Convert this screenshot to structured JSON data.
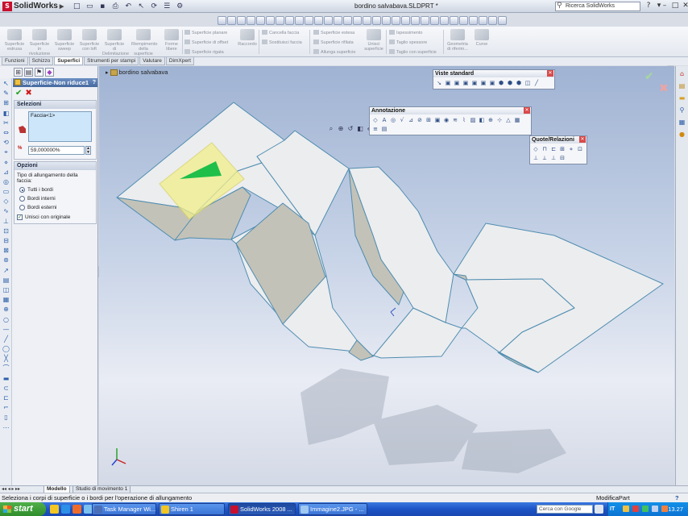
{
  "app": {
    "logo_text": "SolidWorks",
    "document_title": "bordino salvabava.SLDPRT *",
    "search_placeholder": "Ricerca SolidWorks"
  },
  "command_manager": {
    "large_buttons": [
      {
        "label": "Superficie estrusa"
      },
      {
        "label": "Superficie in rivoluzione"
      },
      {
        "label": "Superficie sweep"
      },
      {
        "label": "Superficie con loft"
      },
      {
        "label": "Superficie di Delimitazione"
      },
      {
        "label": "Riempimento della superficie"
      },
      {
        "label": "Forme libere"
      }
    ],
    "col1": [
      "Superficie planare",
      "Superficie di offset",
      "Superficie rigata"
    ],
    "col2": [
      "Cancella faccia",
      "Sostituisci faccia"
    ],
    "col3": [
      "Superficie estesa",
      "Superficie rifilata",
      "Allunga superficie"
    ],
    "unite_label": "Unisci superficie",
    "col4": [
      "Ispessimento",
      "Taglio spessore",
      "Taglio con superficie"
    ],
    "geometry_label": "Geometria di riferim...",
    "curves_label": "Curve",
    "fillet_label": "Raccordo"
  },
  "command_tabs": [
    "Funzioni",
    "Schizzo",
    "Superfici",
    "Strumenti per stampi",
    "Valutare",
    "DimXpert"
  ],
  "active_tab": "Superfici",
  "property_manager": {
    "title": "Superficie-Non riduce1",
    "help": "?",
    "selections_header": "Selezioni",
    "faces_list": [
      "Faccia<1>"
    ],
    "percentage_value": "59,000000%",
    "percentage_icon_label": "%",
    "options_header": "Opzioni",
    "extend_type_label": "Tipo di allungamento della faccia:",
    "radios": [
      {
        "label": "Tutti i bordi",
        "selected": true
      },
      {
        "label": "Bordi interni",
        "selected": false
      },
      {
        "label": "Bordi esterni",
        "selected": false
      }
    ],
    "checkbox_label": "Unisci con originale",
    "checkbox_checked": true
  },
  "graphics": {
    "tree_root": "bordino salvabava"
  },
  "floating_toolbars": {
    "standard_views": {
      "title": "Viste standard",
      "icon_count": 12
    },
    "annotation": {
      "title": "Annotazione",
      "icon_count": 19
    },
    "dimensions": {
      "title": "Quote/Relazioni",
      "icon_count": 10
    }
  },
  "bottom_tabs": [
    "Modello",
    "Studio di movimento 1"
  ],
  "active_bottom_tab": "Modello",
  "status": {
    "message": "Seleziona i corpi di superficie o i bordi per l'operazione di allungamento",
    "mode": "ModificaPart",
    "help": "?"
  },
  "taskbar": {
    "start_label": "start",
    "buttons": [
      {
        "label": "Task Manager Wi...",
        "active": false
      },
      {
        "label": "Shiren 1",
        "active": false
      },
      {
        "label": "SolidWorks 2008 ...",
        "active": true
      },
      {
        "label": "Immagine2.JPG - ...",
        "active": false
      }
    ],
    "search_placeholder": "Cerca con Google",
    "language": "IT",
    "clock": "13.27"
  },
  "colors": {
    "surface_face": "#ecedef",
    "surface_shadow": "#c3c2b8",
    "surface_edge": "#4f8db0",
    "selection_highlight": "#f2ef8a",
    "selection_arrow": "#1fbf4a",
    "taskbar_blue": "#245edc",
    "start_green": "#3a9a36"
  }
}
